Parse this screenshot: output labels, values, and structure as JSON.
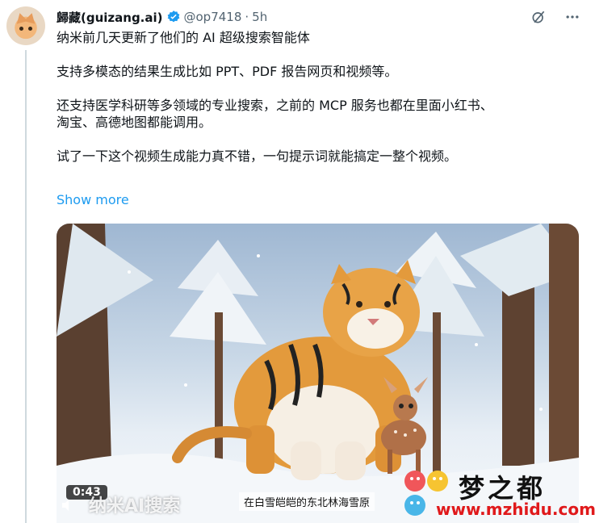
{
  "author": {
    "name": "歸藏(guizang.ai)",
    "handle": "@op7418",
    "separator": "·",
    "time": "5h"
  },
  "icons": [
    "verified-icon",
    "grok-icon",
    "more-icon",
    "play-icon",
    "mute-icon"
  ],
  "tweet": {
    "line1": "纳米前几天更新了他们的 AI 超级搜索智能体",
    "line2": "支持多模态的结果生成比如 PPT、PDF 报告网页和视频等。",
    "line3a": "还支持医学科研等多领域的专业搜索，之前的 MCP 服务也都在里面小红书、",
    "line3b": "淘宝、高德地图都能调用。",
    "line4": "试了一下这个视频生成能力真不错，一句提示词就能搞定一整个视频。",
    "show_more": "Show more"
  },
  "video": {
    "duration": "0:43",
    "overlay_watermark": "纳米AI搜索",
    "subtitle": "在白雪皑皑的东北林海雪原"
  },
  "site_watermark": {
    "name": "梦之都",
    "url": "www.mzhidu.com"
  },
  "colors": {
    "link": "#1d9bf0",
    "verified": "#1d9bf0",
    "secondary_text": "#536471",
    "url_red": "#e0191b"
  }
}
